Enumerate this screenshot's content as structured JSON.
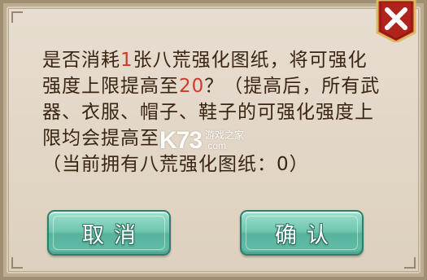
{
  "dialog": {
    "message": {
      "line1_a": "是否消耗",
      "line1_count": "1",
      "line1_b": "张八荒强化图纸，将可强化",
      "line2_a": "强度上限提高至",
      "line2_level": "20",
      "line2_b": "？（提高后，所有武",
      "line3": "器、衣服、帽子、鞋子的可强化强度上",
      "line4": "限均会提高至",
      "line5": "（当前拥有八荒强化图纸：0）"
    },
    "cancel_label": "取消",
    "confirm_label": "确认",
    "close_icon": "close-x-icon"
  },
  "watermark": {
    "logo": "K73",
    "site_cn": "游戏之家",
    "site_url": ".com"
  },
  "colors": {
    "highlight": "#d23a2a",
    "text": "#3a2412",
    "button": "#6cc4ae",
    "close_ribbon": "#b0231c"
  }
}
